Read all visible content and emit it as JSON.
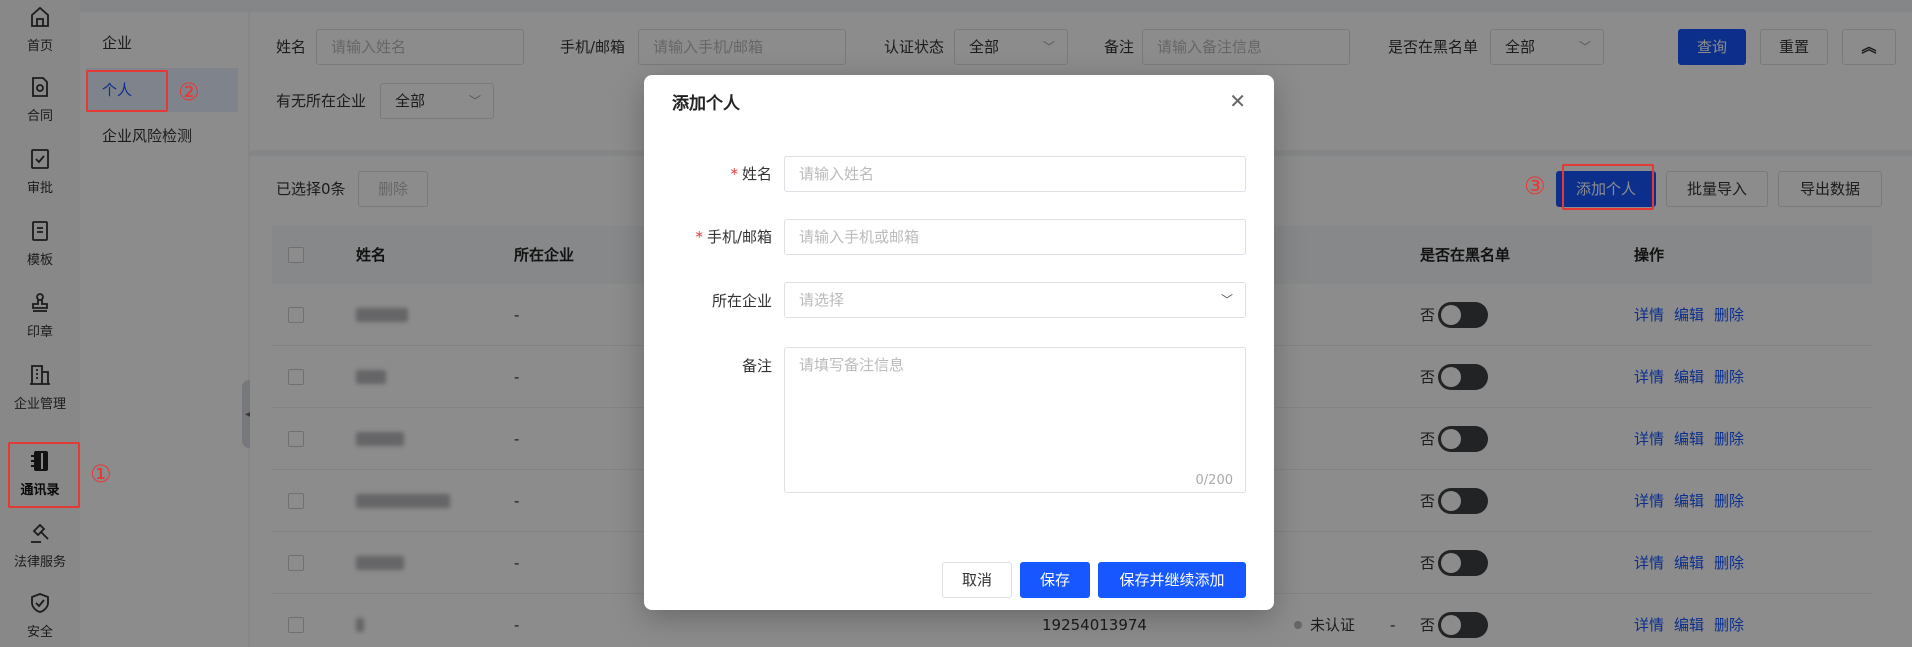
{
  "rail": {
    "items": [
      {
        "label": "首页",
        "icon": "home-icon"
      },
      {
        "label": "合同",
        "icon": "contract-icon"
      },
      {
        "label": "审批",
        "icon": "approval-icon"
      },
      {
        "label": "模板",
        "icon": "template-icon"
      },
      {
        "label": "印章",
        "icon": "seal-icon"
      },
      {
        "label": "企业管理",
        "icon": "enterprise-icon"
      },
      {
        "label": "通讯录",
        "icon": "contacts-icon"
      },
      {
        "label": "法律服务",
        "icon": "legal-icon"
      },
      {
        "label": "安全",
        "icon": "security-icon"
      }
    ],
    "active": "通讯录"
  },
  "annotations": {
    "one": "①",
    "two": "②",
    "three": "③",
    "color": "#e53935"
  },
  "subnav": {
    "items": [
      {
        "label": "企业"
      },
      {
        "label": "个人"
      },
      {
        "label": "企业风险检测"
      }
    ],
    "active": "个人"
  },
  "filters": {
    "name_label": "姓名",
    "name_placeholder": "请输入姓名",
    "phone_label": "手机/邮箱",
    "phone_placeholder": "请输入手机/邮箱",
    "auth_label": "认证状态",
    "auth_value": "全部",
    "remark_label": "备注",
    "remark_placeholder": "请输入备注信息",
    "blacklist_label": "是否在黑名单",
    "blacklist_value": "全部",
    "company_label": "有无所在企业",
    "company_value": "全部",
    "query_btn": "查询",
    "reset_btn": "重置",
    "collapse_icon": "chevrons-up-icon"
  },
  "toolbar": {
    "selected_text": "已选择0条",
    "delete_btn": "删除",
    "add_btn": "添加个人",
    "import_btn": "批量导入",
    "export_btn": "导出数据"
  },
  "table": {
    "columns": [
      "姓名",
      "所在企业",
      "是否在黑名单",
      "操作"
    ],
    "rows": [
      {
        "company": "-",
        "blacklist": "否",
        "actions": [
          "详情",
          "编辑",
          "删除"
        ]
      },
      {
        "company": "-",
        "blacklist": "否",
        "actions": [
          "详情",
          "编辑",
          "删除"
        ]
      },
      {
        "company": "-",
        "blacklist": "否",
        "actions": [
          "详情",
          "编辑",
          "删除"
        ]
      },
      {
        "company": "-",
        "blacklist": "否",
        "actions": [
          "详情",
          "编辑",
          "删除"
        ]
      },
      {
        "company": "-",
        "blacklist": "否",
        "actions": [
          "详情",
          "编辑",
          "删除"
        ]
      },
      {
        "company": "-",
        "blacklist": "否",
        "actions": [
          "详情",
          "编辑",
          "删除"
        ],
        "phone": "19254013974",
        "status": "未认证",
        "remark": "-"
      }
    ]
  },
  "modal": {
    "title": "添加个人",
    "name_label": "姓名",
    "name_placeholder": "请输入姓名",
    "phone_label": "手机/邮箱",
    "phone_placeholder": "请输入手机或邮箱",
    "company_label": "所在企业",
    "company_placeholder": "请选择",
    "remark_label": "备注",
    "remark_placeholder": "请填写备注信息",
    "remark_counter": "0/200",
    "cancel_btn": "取消",
    "save_btn": "保存",
    "save_continue_btn": "保存并继续添加",
    "required_mark": "*"
  },
  "colors": {
    "primary": "#1657ff",
    "highlight": "#e53935"
  }
}
